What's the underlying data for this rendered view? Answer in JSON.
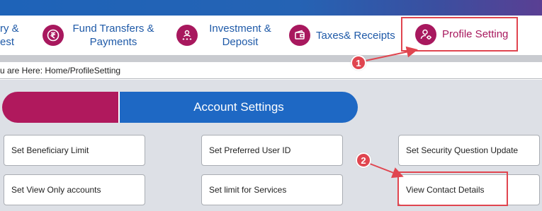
{
  "nav": {
    "items": [
      {
        "label_line1": "ry &",
        "label_line2": "est",
        "icon": "none"
      },
      {
        "label_line1": "Fund Transfers &",
        "label_line2": "Payments",
        "icon": "rupee-transfer-icon"
      },
      {
        "label_line1": "Investment &",
        "label_line2": "Deposit",
        "icon": "investment-people-icon"
      },
      {
        "label": "Taxes& Receipts",
        "icon": "wallet-icon"
      },
      {
        "label": "Profile Setting",
        "icon": "profile-settings-icon"
      }
    ]
  },
  "breadcrumb": {
    "text": "u are Here: Home/ProfileSetting"
  },
  "tabs": {
    "active_label": "Account Settings"
  },
  "options": [
    {
      "label": "Set Beneficiary Limit"
    },
    {
      "label": "Set View Only accounts"
    },
    {
      "label": "Set Preferred User ID"
    },
    {
      "label": "Set limit for Services"
    },
    {
      "label": "Set Security Question Update"
    },
    {
      "label": "View Contact Details"
    }
  ],
  "markers": [
    "1",
    "2"
  ],
  "colors": {
    "brand_magenta": "#a8185e",
    "brand_blue": "#1e68c4",
    "annotation_red": "#e0454f"
  }
}
